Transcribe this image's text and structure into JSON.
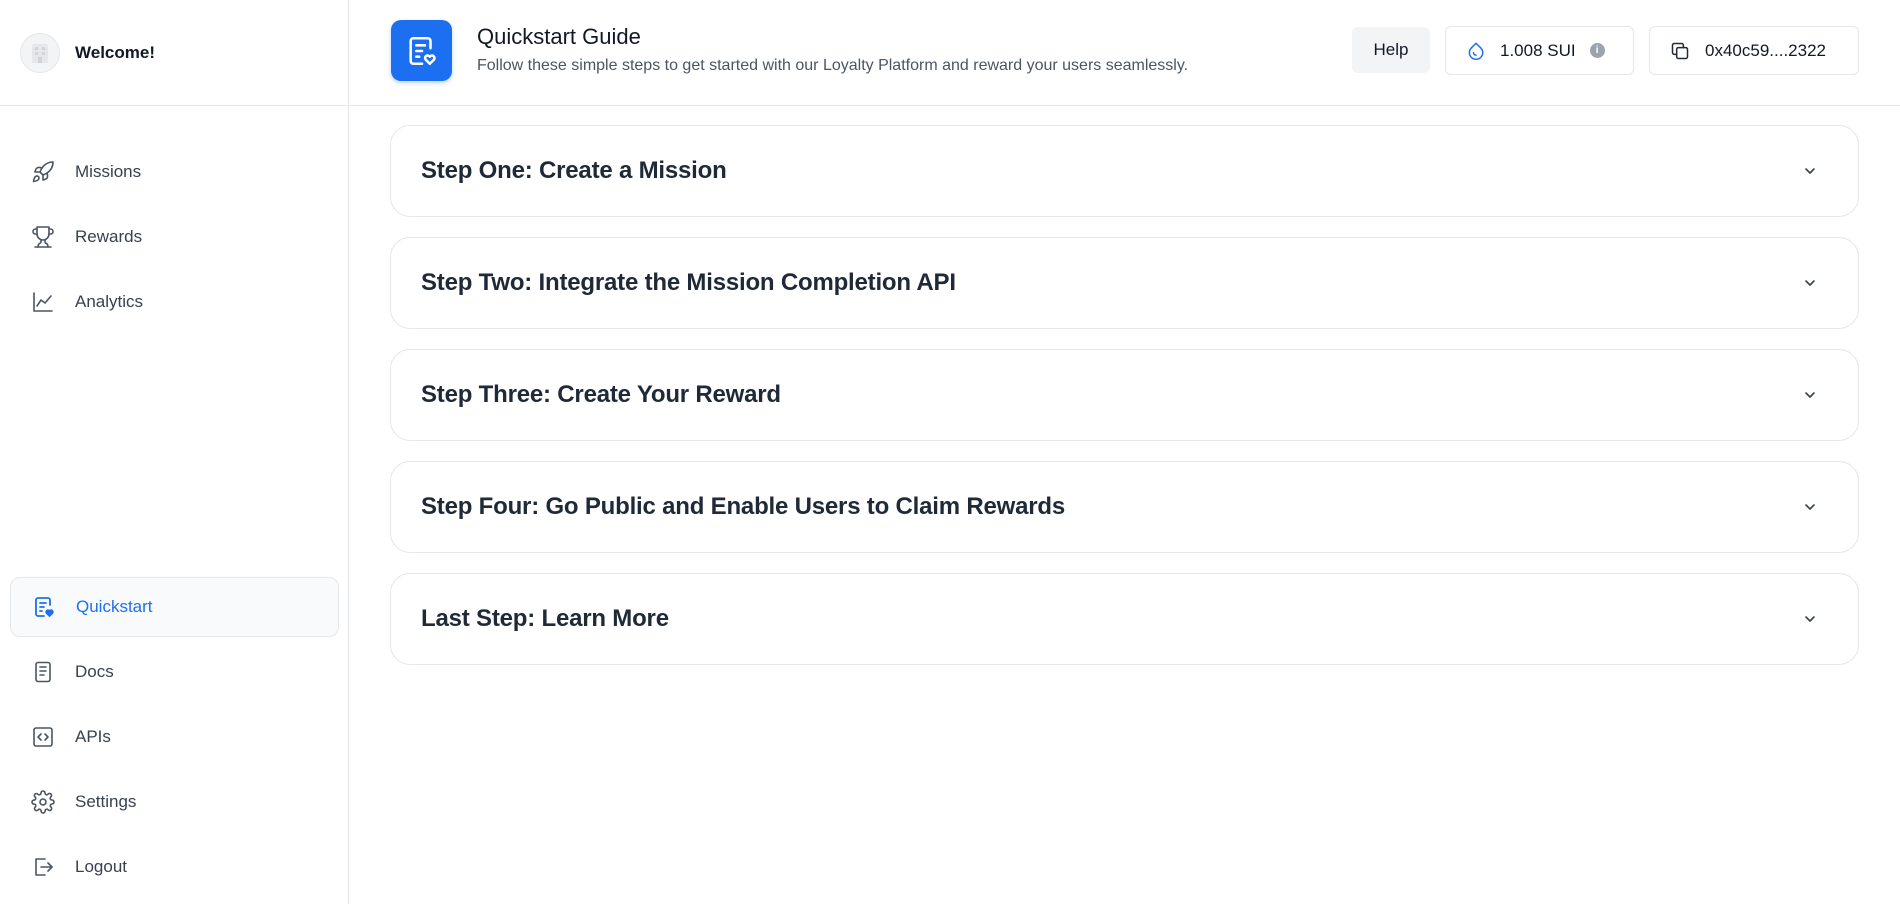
{
  "sidebar": {
    "welcome": "Welcome!",
    "top_items": [
      {
        "label": "Missions",
        "icon": "rocket-icon"
      },
      {
        "label": "Rewards",
        "icon": "trophy-icon"
      },
      {
        "label": "Analytics",
        "icon": "chart-line-icon"
      }
    ],
    "bottom_items": [
      {
        "label": "Quickstart",
        "icon": "quickstart-icon",
        "active": true
      },
      {
        "label": "Docs",
        "icon": "document-icon"
      },
      {
        "label": "APIs",
        "icon": "code-icon"
      },
      {
        "label": "Settings",
        "icon": "gear-icon"
      },
      {
        "label": "Logout",
        "icon": "logout-icon"
      }
    ]
  },
  "header": {
    "title": "Quickstart Guide",
    "subtitle": "Follow these simple steps to get started with our Loyalty Platform and reward your users seamlessly.",
    "help_label": "Help",
    "balance": "1.008 SUI",
    "address": "0x40c59....2322"
  },
  "steps": [
    {
      "title": "Step One: Create a Mission"
    },
    {
      "title": "Step Two: Integrate the Mission Completion API"
    },
    {
      "title": "Step Three: Create Your Reward"
    },
    {
      "title": "Step Four: Go Public and Enable Users to Claim Rewards"
    },
    {
      "title": "Last Step: Learn More"
    }
  ],
  "colors": {
    "accent": "#1d6ff2",
    "border": "#e5e7eb"
  }
}
